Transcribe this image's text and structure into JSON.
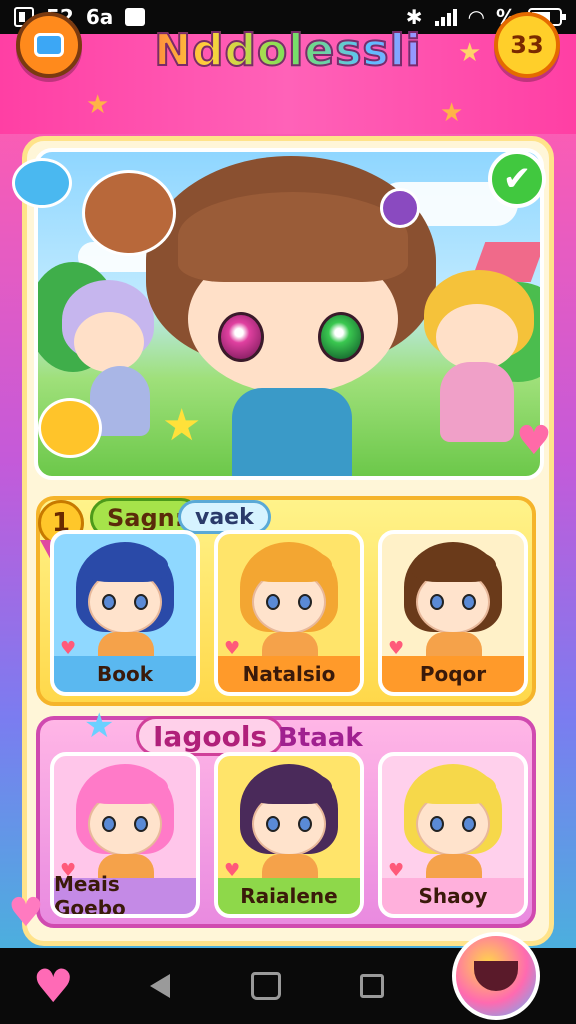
{
  "status_bar": {
    "time": "52",
    "carrier": "6a",
    "wifi_label": "%"
  },
  "header": {
    "title": "Nddolessli",
    "coin_count": "33",
    "menu_icon": "menu-icon"
  },
  "hero": {
    "check_icon": "check-icon"
  },
  "section_1": {
    "rank": "1",
    "tag_a": "Sagn:",
    "tag_b": "vaek",
    "cards": [
      {
        "label": "Book",
        "hair": "#2a4aa8",
        "bg": "#8fd8ff",
        "label_bg": "#5ab8f0"
      },
      {
        "label": "Natalsio",
        "hair": "#f3a632",
        "bg": "#ffe46a",
        "label_bg": "#ff9a2a"
      },
      {
        "label": "Poqor",
        "hair": "#6a3a1a",
        "bg": "#fff1c8",
        "label_bg": "#ff9a2a"
      }
    ]
  },
  "section_2": {
    "tag_a": "Iagools",
    "tag_b": "Btaak",
    "cards": [
      {
        "label": "Meais Goebo",
        "hair": "#ff7ac8",
        "bg": "#ffc6ea",
        "label_bg": "#c48ae6"
      },
      {
        "label": "Raialene",
        "hair": "#4a2a5a",
        "bg": "#ffe46a",
        "label_bg": "#8ed84a"
      },
      {
        "label": "Shaoy",
        "hair": "#f6d84a",
        "bg": "#ffd0ec",
        "label_bg": "#ffb0dc"
      }
    ]
  },
  "navbar": {
    "back_icon": "back-icon",
    "home_icon": "home-icon",
    "recent_icon": "recent-apps-icon"
  },
  "colors": {
    "accent_pink": "#ff3fa4",
    "panel_bg": "#fff6d8",
    "coin": "#ffcf2a"
  }
}
